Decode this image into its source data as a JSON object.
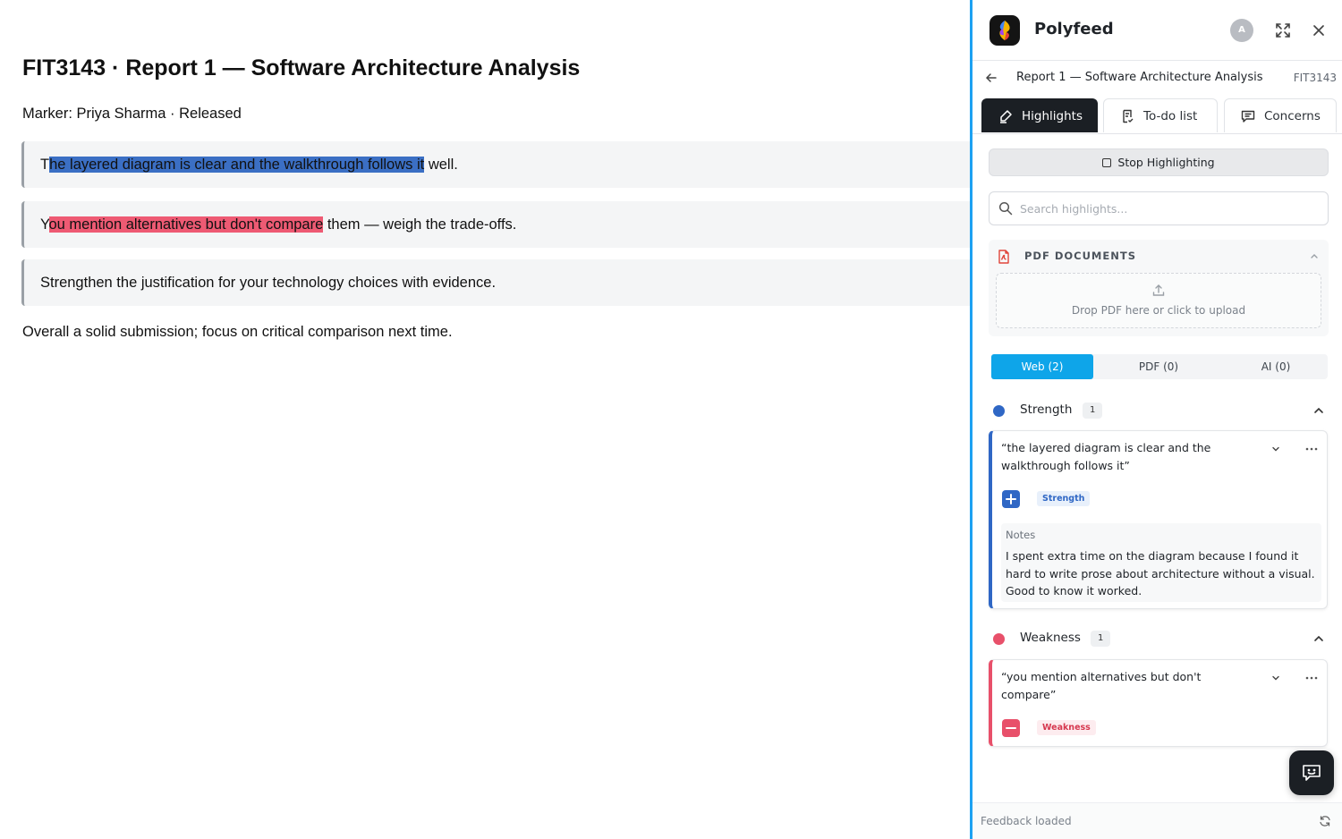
{
  "document": {
    "title": "FIT3143 · Report 1 — Software Architecture Analysis",
    "meta": "Marker: Priya Sharma · Released",
    "feedback": [
      {
        "before": "T",
        "highlight": "he layered diagram is clear and the walkthrough follows it",
        "after": " well."
      },
      {
        "before": "Y",
        "highlight": "ou mention alternatives but don't compare",
        "after": " them — weigh the trade-offs."
      },
      {
        "text": "Strengthen the justification for your technology choices with evidence."
      }
    ],
    "summary": "Overall a solid submission; focus on critical comparison next time."
  },
  "panel": {
    "brand": "Polyfeed",
    "avatar_initial": "A",
    "breadcrumb": {
      "title": "Report 1 — Software Architecture Analysis",
      "code": "FIT3143"
    },
    "tabs": {
      "highlights": "Highlights",
      "todo": "To-do list",
      "concerns": "Concerns"
    },
    "stop_label": "Stop Highlighting",
    "search_placeholder": "Search highlights...",
    "pdf": {
      "label": "PDF DOCUMENTS",
      "drop_text": "Drop PDF here or click to upload"
    },
    "segments": {
      "web": "Web (2)",
      "pdf": "PDF (0)",
      "ai": "AI (0)"
    },
    "categories": {
      "strength": {
        "name": "Strength",
        "count": "1",
        "color": "#2f67c5",
        "card": {
          "quote": "“the layered diagram is clear and the walkthrough follows it”",
          "tag": "Strength",
          "notes_label": "Notes",
          "notes": "I spent extra time on the diagram because I found it hard to write prose about architecture without a visual. Good to know it worked."
        }
      },
      "weakness": {
        "name": "Weakness",
        "count": "1",
        "color": "#e8506a",
        "card": {
          "quote": "“you mention alternatives but don't compare”",
          "tag": "Weakness"
        }
      }
    },
    "status": "Feedback loaded",
    "colors": {
      "accent": "#1da1f2",
      "web_segment": "#0ea5e9",
      "dark": "#1b1f24"
    }
  }
}
